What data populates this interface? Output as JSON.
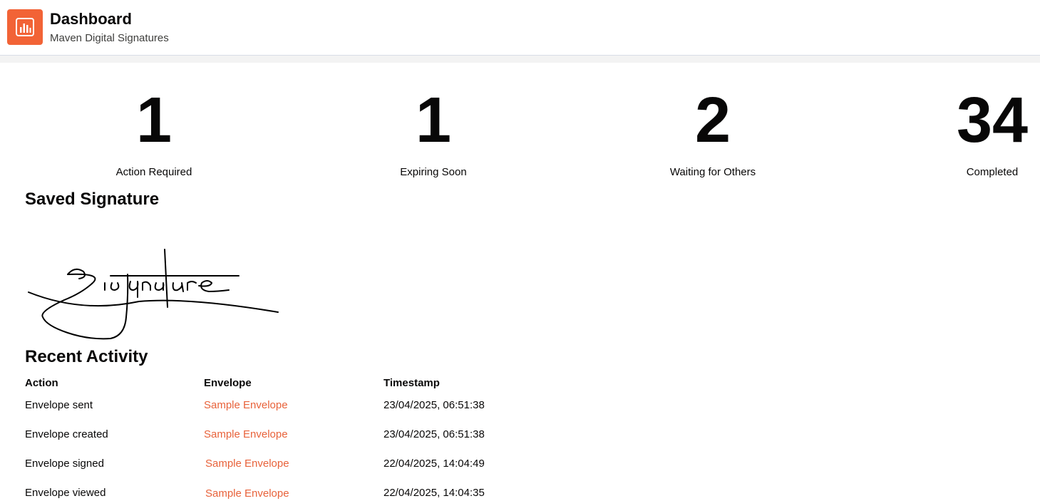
{
  "header": {
    "title": "Dashboard",
    "subtitle": "Maven Digital Signatures",
    "icon": "bar-chart-icon",
    "accent_color": "#f26336"
  },
  "stats": [
    {
      "value": "1",
      "label": "Action Required"
    },
    {
      "value": "1",
      "label": "Expiring Soon"
    },
    {
      "value": "2",
      "label": "Waiting for Others"
    },
    {
      "value": "34",
      "label": "Completed"
    }
  ],
  "saved_signature": {
    "title": "Saved Signature",
    "signature_text": "Signature"
  },
  "recent_activity": {
    "title": "Recent Activity",
    "columns": [
      "Action",
      "Envelope",
      "Timestamp"
    ],
    "rows": [
      {
        "action": "Envelope sent",
        "envelope": "Sample Envelope",
        "timestamp": "23/04/2025, 06:51:38"
      },
      {
        "action": "Envelope created",
        "envelope": "Sample Envelope",
        "timestamp": "23/04/2025, 06:51:38"
      },
      {
        "action": "Envelope signed",
        "envelope": "Sample Envelope",
        "timestamp": "22/04/2025, 14:04:49"
      },
      {
        "action": "Envelope viewed",
        "envelope": "Sample Envelope",
        "timestamp": "22/04/2025, 14:04:35"
      }
    ]
  },
  "colors": {
    "link": "#e8623a",
    "border": "#d8dde6"
  }
}
